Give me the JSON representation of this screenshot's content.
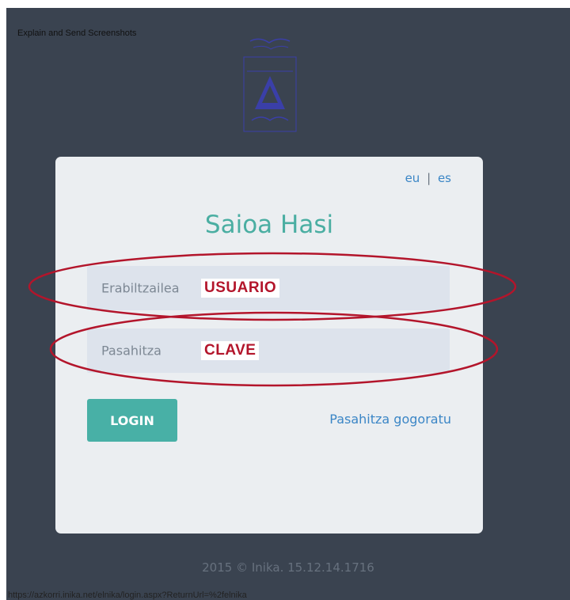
{
  "top_caption": "Explain and Send Screenshots",
  "logo": {
    "icon": "triangle-emblem-icon",
    "color": "#3a3fa8"
  },
  "lang": {
    "eu": "eu",
    "separator": "|",
    "es": "es"
  },
  "title": "Saioa Hasi",
  "username_field": {
    "placeholder": "Erabiltzailea",
    "annotation": "USUARIO"
  },
  "password_field": {
    "placeholder": "Pasahitza",
    "annotation": "CLAVE"
  },
  "login_button": "LOGIN",
  "forgot_link": "Pasahitza gogoratu",
  "footer": "2015 © Inika. 15.12.14.1716",
  "status_url": "https://azkorri.inika.net/elnika/login.aspx?ReturnUrl=%2felnika",
  "colors": {
    "background": "#3a4350",
    "card": "#ebeef1",
    "accent": "#48b0a6",
    "link": "#3b86c6",
    "annotation": "#b3152b"
  }
}
